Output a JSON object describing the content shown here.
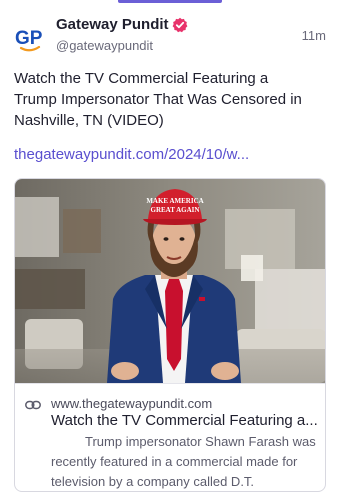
{
  "post": {
    "author_name": "Gateway Pundit",
    "handle": "@gatewaypundit",
    "timestamp": "11m",
    "avatar_text": "GP",
    "text": "Watch the TV Commercial Featuring a Trump Impersonator That Was Censored in Nashville, TN (VIDEO)",
    "link_text": "thegatewaypundit.com/2024/10/w..."
  },
  "card": {
    "domain": "www.thegatewaypundit.com",
    "title": "Watch the TV Commercial Featuring a...",
    "description": "Trump impersonator Shawn Farash was recently featured in a commercial made for television by a company called D.T.",
    "hat_text_line1": "MAKE AMERICA",
    "hat_text_line2": "GREAT AGAIN"
  },
  "colors": {
    "accent": "#5a4fcf",
    "verified_badge": "#e8336b",
    "avatar_blue": "#1a4fb8",
    "avatar_orange": "#f39a1f"
  },
  "icons": {
    "verified": "verified-badge-icon",
    "link": "link-icon"
  }
}
